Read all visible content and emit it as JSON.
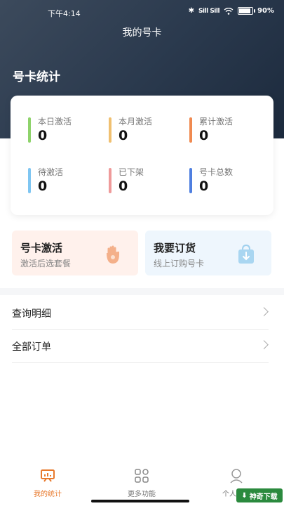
{
  "status_bar": {
    "time": "下午4:14",
    "signal": "Sill Sill",
    "battery": "90%",
    "battery_level": 0.9
  },
  "header": {
    "title": "我的号卡",
    "section_title": "号卡统计"
  },
  "stats": [
    {
      "label": "本日激活",
      "value": "0",
      "color": "#8ed36b"
    },
    {
      "label": "本月激活",
      "value": "0",
      "color": "#f0c070"
    },
    {
      "label": "累计激活",
      "value": "0",
      "color": "#f08a50"
    },
    {
      "label": "待激活",
      "value": "0",
      "color": "#7fc6f2"
    },
    {
      "label": "已下架",
      "value": "0",
      "color": "#ef9a9a"
    },
    {
      "label": "号卡总数",
      "value": "0",
      "color": "#4f7fe0"
    }
  ],
  "actions": [
    {
      "title": "号卡激活",
      "subtitle": "激活后选套餐",
      "icon": "activate-icon",
      "bg": "#fff1ec"
    },
    {
      "title": "我要订货",
      "subtitle": "线上订购号卡",
      "icon": "order-bag-icon",
      "bg": "#eef6fd"
    }
  ],
  "list": [
    {
      "label": "查询明细"
    },
    {
      "label": "全部订单"
    }
  ],
  "tabbar": {
    "items": [
      {
        "label": "我的统计",
        "icon": "stats-icon",
        "active": true
      },
      {
        "label": "更多功能",
        "icon": "grid-icon",
        "active": false
      },
      {
        "label": "个人中心",
        "icon": "profile-icon",
        "active": false
      }
    ],
    "active_color": "#e8792c"
  },
  "watermark": {
    "text": "神奇下载"
  }
}
